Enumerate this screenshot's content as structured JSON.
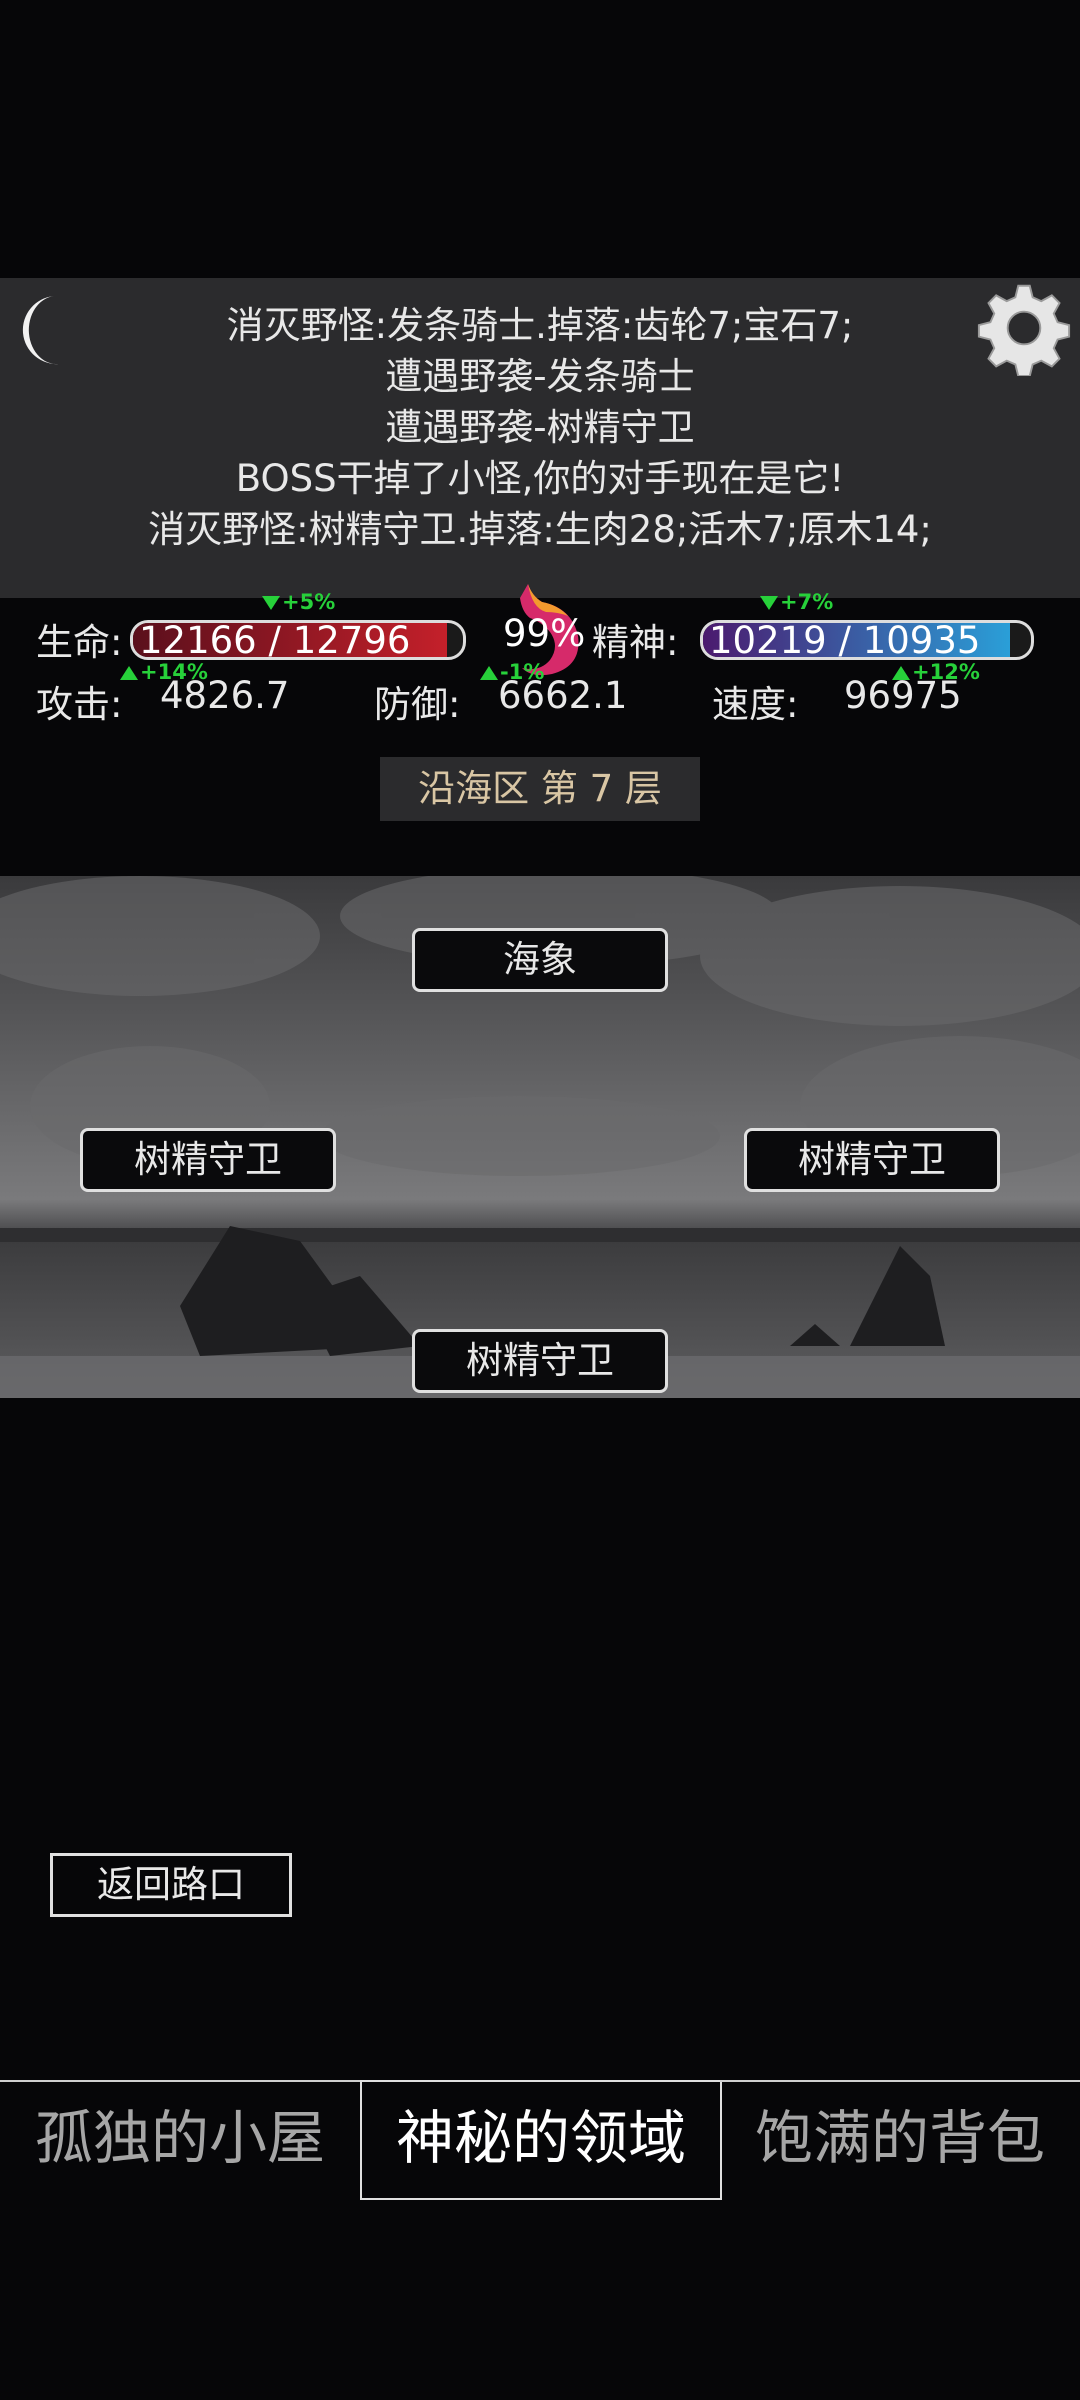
{
  "log": {
    "lines": [
      "消灭野怪:发条骑士.掉落:齿轮7;宝石7;",
      "遭遇野袭-发条骑士",
      "遭遇野袭-树精守卫",
      "BOSS干掉了小怪,你的对手现在是它!",
      "消灭野怪:树精守卫.掉落:生肉28;活木7;原木14;"
    ]
  },
  "stats": {
    "life_label": "生命:",
    "life_text": "12166 / 12796",
    "life_current": 12166,
    "life_max": 12796,
    "life_delta": "+5%",
    "satiety_pct": "99%",
    "spirit_label": "精神:",
    "spirit_text": "10219 / 10935",
    "spirit_current": 10219,
    "spirit_max": 10935,
    "spirit_delta": "+7%",
    "attack_label": "攻击:",
    "attack_value": "4826.7",
    "attack_delta": "+14%",
    "defense_label": "防御:",
    "defense_value": "6662.1",
    "defense_delta": "-1%",
    "speed_label": "速度:",
    "speed_value": "96975",
    "speed_delta": "+12%"
  },
  "area": {
    "title": "沿海区 第 7 层"
  },
  "enemies": {
    "top": "海象",
    "left": "树精守卫",
    "right": "树精守卫",
    "bottom": "树精守卫"
  },
  "back_label": "返回路口",
  "tabs": [
    {
      "label": "孤独的小屋",
      "active": false
    },
    {
      "label": "神秘的领域",
      "active": true
    },
    {
      "label": "饱满的背包",
      "active": false
    }
  ],
  "colors": {
    "life_bar": "#c4202a",
    "spirit_bar": "#2a9fd8",
    "delta_green": "#27d13a",
    "area_title_text": "#d9c6a4"
  }
}
